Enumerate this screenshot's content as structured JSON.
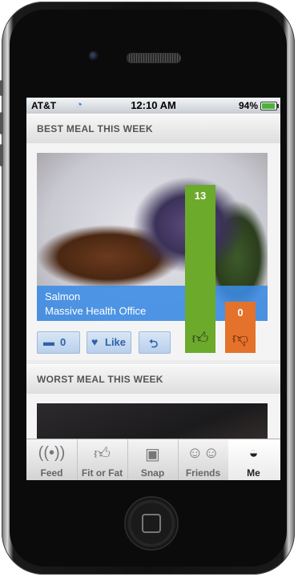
{
  "status": {
    "carrier": "AT&T",
    "time": "12:10 AM",
    "battery": "94%",
    "battery_level": 0.94
  },
  "sections": {
    "best": {
      "title": "BEST MEAL THIS WEEK",
      "meal_name": "Salmon",
      "location": "Massive Health Office",
      "comments_count": "0",
      "like_label": "Like",
      "votes_up": "13",
      "votes_down": "0"
    },
    "worst": {
      "title": "WORST MEAL THIS WEEK"
    }
  },
  "tabs": [
    {
      "label": "Feed",
      "icon": "broadcast-icon"
    },
    {
      "label": "Fit or Fat",
      "icon": "thumbs-icon"
    },
    {
      "label": "Snap",
      "icon": "camera-icon"
    },
    {
      "label": "Friends",
      "icon": "people-icon"
    },
    {
      "label": "Me",
      "icon": "gauge-icon"
    }
  ],
  "colors": {
    "accent": "#3c8ce6",
    "up": "#6caa2c",
    "down": "#e4722a"
  }
}
